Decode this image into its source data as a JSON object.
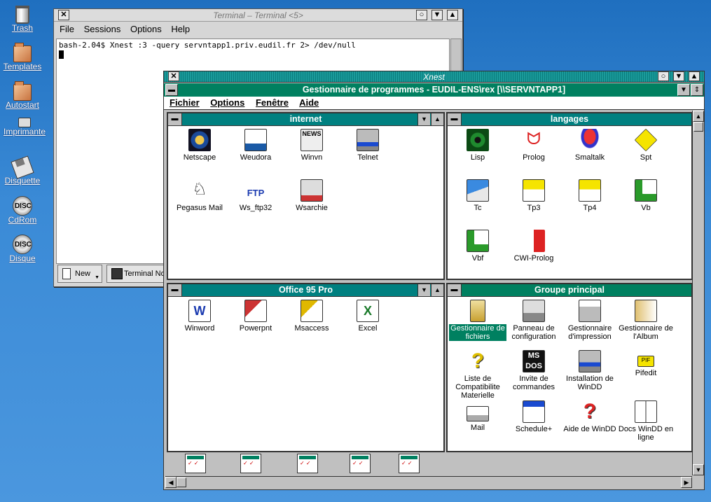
{
  "desktop": {
    "icons": [
      {
        "label": "Trash",
        "icon": "trash-icon"
      },
      {
        "label": "Templates",
        "icon": "folder-icon"
      },
      {
        "label": "Autostart",
        "icon": "folder-icon"
      },
      {
        "label": "Imprimante",
        "icon": "printer-icon"
      },
      {
        "label": "Disquette",
        "icon": "floppy-icon"
      },
      {
        "label": "CdRom",
        "icon": "disc-icon"
      },
      {
        "label": "Disque",
        "icon": "disc-icon"
      }
    ],
    "disc_text": "DISC"
  },
  "terminal": {
    "title": "Terminal – Terminal <5>",
    "menu": [
      "File",
      "Sessions",
      "Options",
      "Help"
    ],
    "command": "bash-2.04$ Xnest :3 -query servntapp1.priv.eudil.fr 2> /dev/null",
    "tabs": {
      "new": "New",
      "terminal": "Terminal No"
    }
  },
  "xnest": {
    "title": "Xnest",
    "progman_title": "Gestionnaire de programmes - EUDIL-ENS\\rex [\\\\SERVNTAPP1]",
    "menu": [
      "Fichier",
      "Options",
      "Fenêtre",
      "Aide"
    ],
    "groups": {
      "internet": {
        "title": "internet",
        "items": [
          "Netscape",
          "Weudora",
          "Winvn",
          "Telnet",
          "Pegasus Mail",
          "Ws_ftp32",
          "Wsarchie"
        ]
      },
      "langages": {
        "title": "langages",
        "items": [
          "Lisp",
          "Prolog",
          "Smaltalk",
          "Spt",
          "Tc",
          "Tp3",
          "Tp4",
          "Vb",
          "Vbf",
          "CWI-Prolog"
        ]
      },
      "office": {
        "title": "Office 95 Pro",
        "items": [
          "Winword",
          "Powerpnt",
          "Msaccess",
          "Excel"
        ]
      },
      "principal": {
        "title": "Groupe principal",
        "items": [
          "Gestionnaire de fichiers",
          "Panneau de configuration",
          "Gestionnaire d'impression",
          "Gestionnaire de l'Album",
          "Liste de Compatibilite Materielle",
          "Invite de commandes",
          "Installation de WinDD",
          "Pifedit",
          "Mail",
          "Schedule+",
          "Aide de WinDD",
          "Docs WinDD en ligne"
        ]
      }
    },
    "minimized_count": 5
  }
}
